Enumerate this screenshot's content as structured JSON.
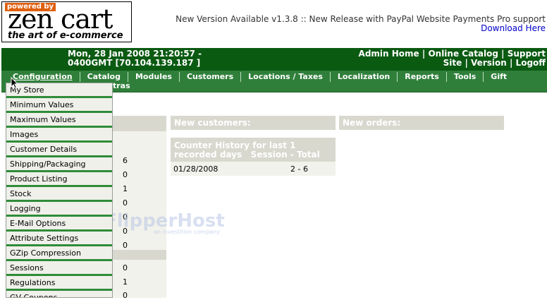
{
  "header": {
    "logo_powered": "powered by",
    "logo_brand": "zen cart",
    "logo_tagline": "the art of e-commerce",
    "new_version_text": "New Version Available v1.3.8 :: New Release with PayPal Website Payments Pro support",
    "download_link": "Download Here"
  },
  "status": {
    "datetime_line1": "Mon, 28 Jan 2008 21:20:57 -",
    "datetime_line2": "0400GMT [70.104.139.187 ]"
  },
  "top_links": {
    "admin_home": "Admin Home",
    "online_catalog": "Online Catalog",
    "support_site_1": "Support",
    "support_site_2": "Site",
    "version": "Version",
    "logoff": "Logoff",
    "separator": "|"
  },
  "nav": {
    "items": [
      "Configuration",
      "Catalog",
      "Modules",
      "Customers",
      "Locations / Taxes",
      "Localization",
      "Reports",
      "Tools",
      "Gift"
    ],
    "second_row": "tras"
  },
  "config_menu": {
    "items": [
      "My Store",
      "Minimum Values",
      "Maximum Values",
      "Images",
      "Customer Details",
      "Shipping/Packaging",
      "Product Listing",
      "Stock",
      "Logging",
      "E-Mail Options",
      "Attribute Settings",
      "GZip Compression",
      "Sessions",
      "Regulations",
      "GV Coupons"
    ]
  },
  "stats_values": [
    "6",
    "0",
    "1",
    "0",
    "0",
    "0",
    "0",
    "0",
    "1",
    "0"
  ],
  "panels": {
    "new_customers": "New customers:",
    "new_orders": "New orders:",
    "counter_title_1": "Counter History for last 1",
    "counter_title_2": "recorded days",
    "counter_col": "Session - Total",
    "counter_date": "01/28/2008",
    "counter_value": "2 - 6"
  },
  "watermark": {
    "brand": "FlipperHost",
    "sub": "an investition company"
  },
  "colors": {
    "dark_green": "#0b5a12",
    "nav_green": "#2f7f3a",
    "menu_separator": "#2f8c38",
    "panel_header": "#d8d8cf",
    "link_blue": "#0000cc"
  }
}
